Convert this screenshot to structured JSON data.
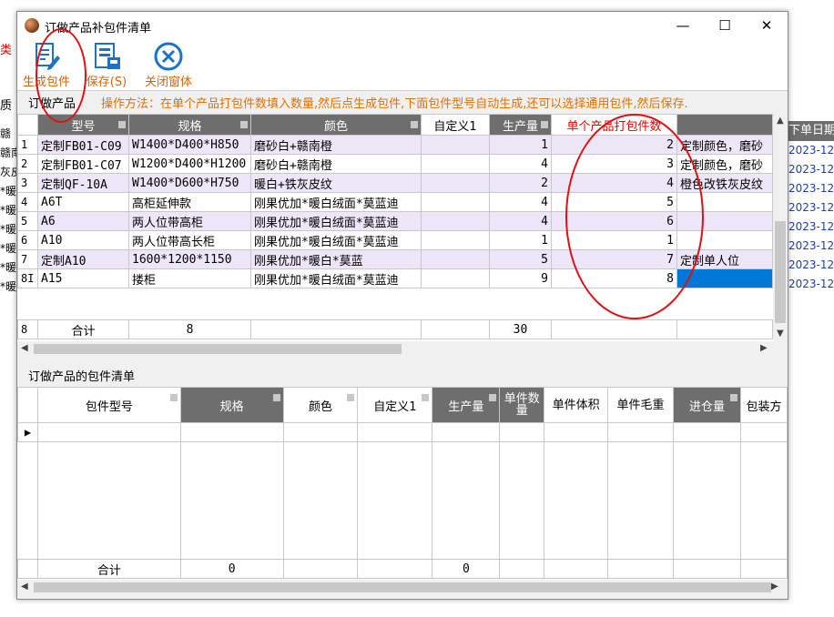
{
  "window": {
    "title": "订做产品补包件清单",
    "controls": {
      "minimize": "—",
      "maximize": "☐",
      "close": "✕"
    }
  },
  "toolbar": {
    "generate_label": "生成包件",
    "save_label": "保存(S)",
    "close_label": "关闭窗体"
  },
  "background": {
    "red_text": "类",
    "left_label": "质",
    "left_cells": [
      "赣",
      "赣南",
      "灰皮",
      "*暖",
      "*暖",
      "*暖",
      "*暖",
      "*暖",
      "*暖"
    ],
    "right_header": "下单日期",
    "right_cells": [
      "2023-12",
      "2023-12",
      "2023-12",
      "2023-12",
      "2023-12",
      "2023-12",
      "2023-12",
      "2023-12"
    ]
  },
  "top_section": {
    "title": "订做产品",
    "instruction": "操作方法：在单个产品打包件数填入数量,然后点生成包件,下面包件型号自动生成,还可以选择通用包件,然后保存.",
    "headers": [
      "型号",
      "规格",
      "颜色",
      "自定义1",
      "生产量",
      "单个产品打包件数",
      ""
    ],
    "rows": [
      {
        "n": "1",
        "model": "定制FB01-C09",
        "spec": "W1400*D400*H850",
        "color": "磨砂白+赣南橙",
        "custom": "",
        "qty": "1",
        "packs": "2",
        "note": "定制颜色，磨砂"
      },
      {
        "n": "2",
        "model": "定制FB01-C07",
        "spec": "W1200*D400*H1200",
        "color": "磨砂白+赣南橙",
        "custom": "",
        "qty": "4",
        "packs": "3",
        "note": "定制颜色，磨砂"
      },
      {
        "n": "3",
        "model": "定制QF-10A",
        "spec": "W1400*D600*H750",
        "color": "暖白+铁灰皮纹",
        "custom": "",
        "qty": "2",
        "packs": "4",
        "note": "橙色改铁灰皮纹"
      },
      {
        "n": "4",
        "model": "A6T",
        "spec": "高柜延伸款",
        "color": "刚果优加*暖白绒面*莫蓝迪",
        "custom": "",
        "qty": "4",
        "packs": "5",
        "note": ""
      },
      {
        "n": "5",
        "model": "A6",
        "spec": "两人位带高柜",
        "color": "刚果优加*暖白绒面*莫蓝迪",
        "custom": "",
        "qty": "4",
        "packs": "6",
        "note": ""
      },
      {
        "n": "6",
        "model": "A10",
        "spec": "两人位带高长柜",
        "color": "刚果优加*暖白绒面*莫蓝迪",
        "custom": "",
        "qty": "1",
        "packs": "1",
        "note": ""
      },
      {
        "n": "7",
        "model": "定制A10",
        "spec": "1600*1200*1150",
        "color": "刚果优加*暖白*莫蓝",
        "custom": "",
        "qty": "5",
        "packs": "7",
        "note": "定制单人位"
      },
      {
        "n": "8I",
        "model": "A15",
        "spec": "搂柜",
        "color": "刚果优加*暖白绒面*莫蓝迪",
        "custom": "",
        "qty": "9",
        "packs": "8",
        "note": ""
      }
    ],
    "summary": {
      "n": "8",
      "label": "合计",
      "count": "8",
      "qty_total": "30"
    }
  },
  "bottom_section": {
    "title": "订做产品的包件清单",
    "headers": [
      "包件型号",
      "规格",
      "颜色",
      "自定义1",
      "生产量",
      "单件数量",
      "单件体积",
      "单件毛重",
      "进仓量",
      "包装方"
    ],
    "current_row_marker": "▶",
    "summary": {
      "label": "合计",
      "spec_total": "0",
      "qty_total": "0"
    }
  },
  "colors": {
    "accent_orange": "#d46400",
    "instruction_orange": "#e07000",
    "header_gray": "#6e6e6e",
    "row_lavender": "#ece6f8",
    "selection_blue": "#0078d7",
    "annotation_red": "#e01010"
  }
}
